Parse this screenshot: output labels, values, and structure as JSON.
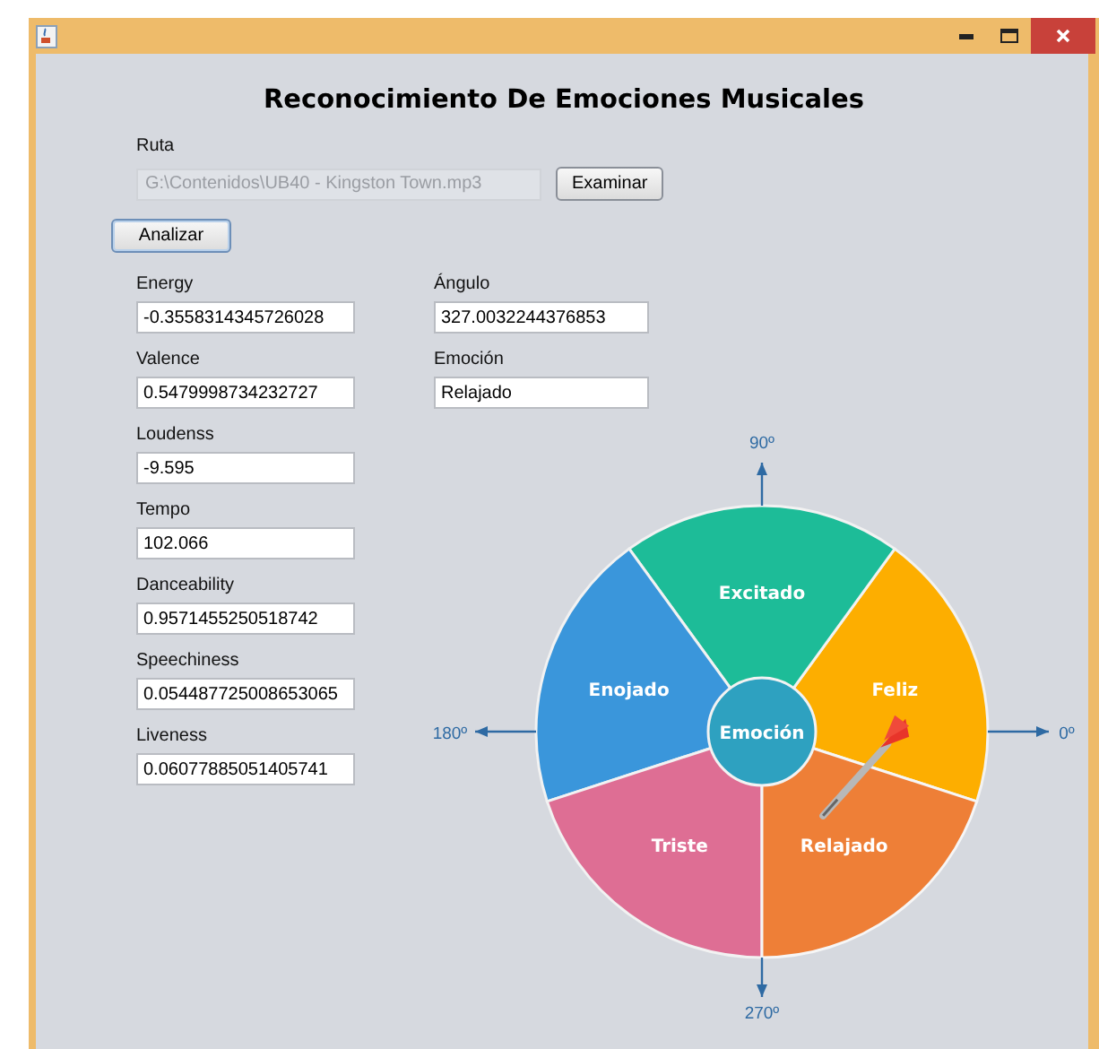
{
  "heading": "Reconocimiento De Emociones Musicales",
  "path": {
    "label": "Ruta",
    "value": "G:\\Contenidos\\UB40 - Kingston Town.mp3",
    "disabled": true,
    "browse_button": "Examinar"
  },
  "analyze_button": "Analizar",
  "features": [
    {
      "label": "Energy",
      "value": "-0.3558314345726028"
    },
    {
      "label": "Valence",
      "value": "0.5479998734232727"
    },
    {
      "label": "Loudenss",
      "value": "-9.595"
    },
    {
      "label": "Tempo",
      "value": "102.066"
    },
    {
      "label": "Danceability",
      "value": "0.9571455250518742"
    },
    {
      "label": "Speechiness",
      "value": "0.054487725008653065"
    },
    {
      "label": "Liveness",
      "value": "0.06077885051405741"
    }
  ],
  "results": [
    {
      "label": "Ángulo",
      "value": "327.0032244376853"
    },
    {
      "label": "Emoción",
      "value": "Relajado"
    }
  ],
  "wheel": {
    "center": "Emoción",
    "segments": [
      {
        "label": "Feliz",
        "color": "#fdae00",
        "selected": false
      },
      {
        "label": "Excitado",
        "color": "#1dbc98",
        "selected": false
      },
      {
        "label": "Enojado",
        "color": "#3a96db",
        "selected": false
      },
      {
        "label": "Triste",
        "color": "#de6e94",
        "selected": false
      },
      {
        "label": "Relajado",
        "color": "#ee7f37",
        "selected": true
      }
    ],
    "axes": [
      {
        "label": "0º"
      },
      {
        "label": "90º"
      },
      {
        "label": "180º"
      },
      {
        "label": "270º"
      }
    ]
  }
}
